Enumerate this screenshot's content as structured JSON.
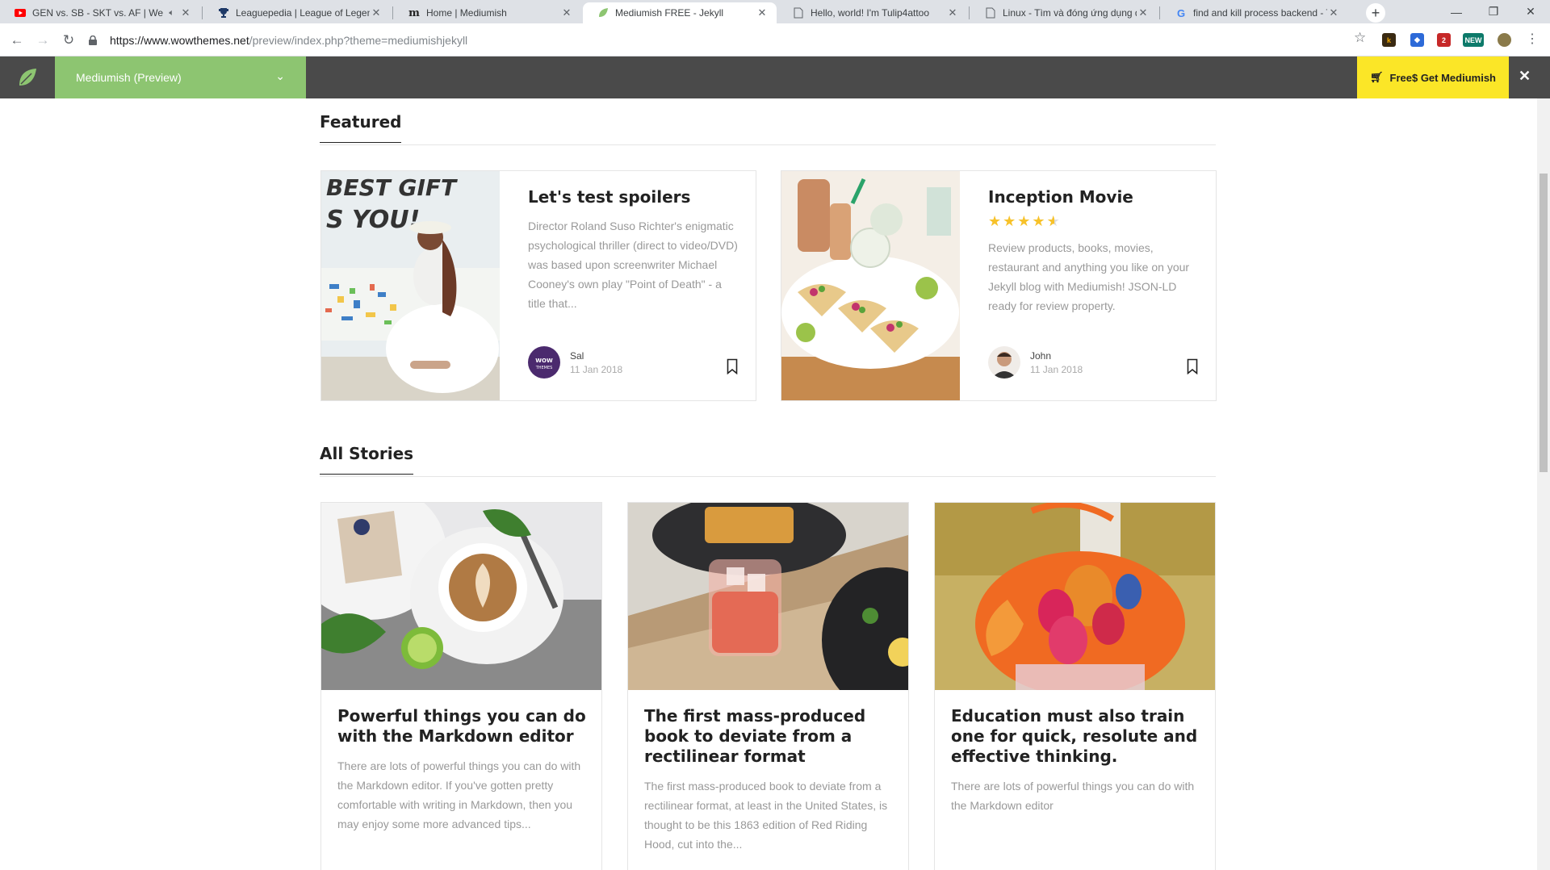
{
  "browser": {
    "tabs": [
      {
        "title": "GEN vs. SB - SKT vs. AF | We",
        "favicon": "youtube-icon",
        "color": "#ff0000"
      },
      {
        "title": "Leaguepedia | League of Legend",
        "favicon": "trophy-icon",
        "color": "#1f3a68"
      },
      {
        "title": "Home | Mediumish",
        "favicon": "m-icon",
        "color": "#222222"
      },
      {
        "title": "Mediumish FREE - Jekyll",
        "favicon": "leaf-icon",
        "color": "#8dc571"
      },
      {
        "title": "Hello, world! I'm Tulip4attoo",
        "favicon": "page-icon",
        "color": "#5f6368"
      },
      {
        "title": "Linux - Tìm và đóng ứng dụng đ",
        "favicon": "page-icon",
        "color": "#5f6368"
      },
      {
        "title": "find and kill process backend - T",
        "favicon": "google-icon",
        "color": "#4285f4"
      }
    ],
    "url_host": "https://www.wowthemes.net",
    "url_path": "/preview/index.php?theme=mediumishjekyll"
  },
  "preview_bar": {
    "theme_name": "Mediumish (Preview)",
    "buy_label": "Free$  Get Mediumish",
    "colors": {
      "bar": "#4a4a4a",
      "select": "#8dc571",
      "buy": "#fbe627"
    }
  },
  "featured": {
    "heading": "Featured",
    "cards": [
      {
        "title": "Let's test spoilers",
        "excerpt": "Director Roland Suso Richter's enigmatic psychological thriller (direct to video/DVD) was based upon screenwriter Michael Cooney's own play \"Point of Death\" - a title that...",
        "author": "Sal",
        "date": "11 Jan 2018"
      },
      {
        "title": "Inception Movie",
        "rating": 4.5,
        "excerpt": "Review products, books, movies, restaurant and anything you like on your Jekyll blog with Mediumish! JSON-LD ready for review property.",
        "author": "John",
        "date": "11 Jan 2018"
      }
    ]
  },
  "all_stories": {
    "heading": "All Stories",
    "cards": [
      {
        "title": "Powerful things you can do with the Markdown editor",
        "excerpt": "There are lots of powerful things you can do with the Markdown editor. If you've gotten pretty comfortable with writing in Markdown, then you may enjoy some more advanced tips..."
      },
      {
        "title": "The first mass-produced book to deviate from a rectilinear format",
        "excerpt": "The first mass-produced book to deviate from a rectilinear format, at least in the United States, is thought to be this 1863 edition of Red Riding Hood, cut into the..."
      },
      {
        "title": "Education must also train one for quick, resolute and effective thinking.",
        "excerpt": "There are lots of powerful things you can do with the Markdown editor"
      }
    ]
  }
}
